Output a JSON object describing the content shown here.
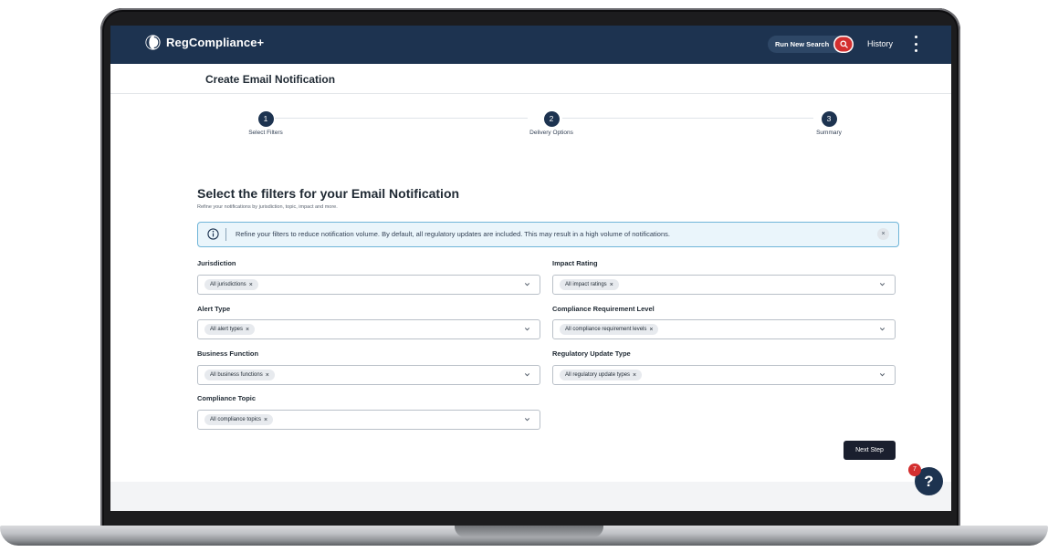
{
  "app": {
    "brand_name": "RegCompliance+"
  },
  "navbar": {
    "run_search_label": "Run New Search",
    "search_icon": "search-icon",
    "history_label": "History",
    "menu_icon": "kebab-menu-icon"
  },
  "page": {
    "title": "Create Email Notification"
  },
  "stepper": {
    "steps": [
      {
        "number": "1",
        "label": "Select Filters"
      },
      {
        "number": "2",
        "label": "Delivery Options"
      },
      {
        "number": "3",
        "label": "Summary"
      }
    ]
  },
  "section": {
    "title": "Select the filters for your Email Notification",
    "subtitle": "Refine your notifications by jurisdiction, topic, impact and more."
  },
  "alert": {
    "text": "Refine your filters to reduce notification volume. By default, all regulatory updates are included. This may result in a high volume of notifications.",
    "close_glyph": "×",
    "icon": "info-icon"
  },
  "filters": {
    "jurisdiction": {
      "label": "Jurisdiction",
      "chip": "All jurisdictions"
    },
    "impact_rating": {
      "label": "Impact Rating",
      "chip": "All impact ratings"
    },
    "alert_type": {
      "label": "Alert Type",
      "chip": "All alert types"
    },
    "compliance_requirement_level": {
      "label": "Compliance Requirement Level",
      "chip": "All compliance requirement levels"
    },
    "business_function": {
      "label": "Business Function",
      "chip": "All business functions"
    },
    "regulatory_update_type": {
      "label": "Regulatory Update Type",
      "chip": "All regulatory update types"
    },
    "compliance_topic": {
      "label": "Compliance Topic",
      "chip": "All compliance topics"
    },
    "chip_remove_glyph": "×"
  },
  "actions": {
    "next_step_label": "Next Step"
  },
  "help": {
    "glyph": "?",
    "badge_count": "7"
  },
  "colors": {
    "navbar": "#1d3350",
    "accent_red": "#d32f2f",
    "alert_border": "#6fb5d8",
    "alert_bg": "#eaf5fb",
    "button_dark": "#1a1f2e"
  }
}
